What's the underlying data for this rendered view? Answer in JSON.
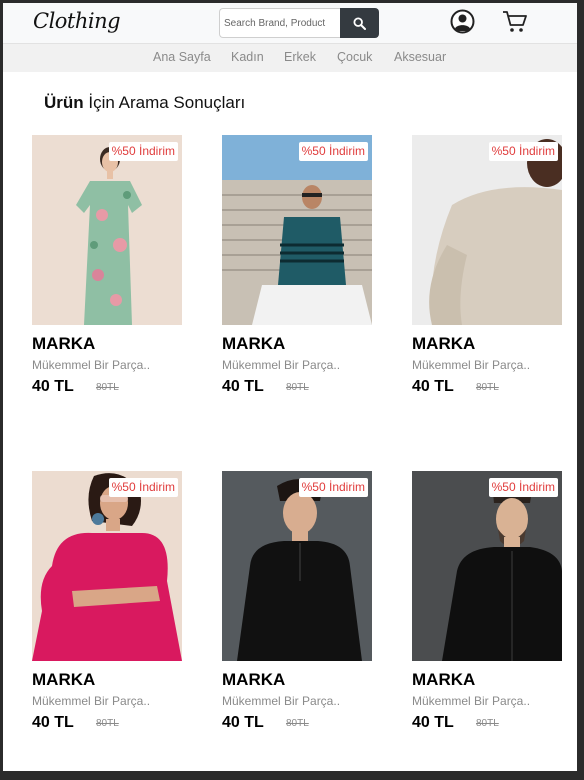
{
  "header": {
    "logo": "Clothing",
    "search": {
      "placeholder": "Search Brand, Product",
      "value": ""
    },
    "icons": {
      "search": "search-icon",
      "user": "user-account-icon",
      "cart": "shopping-cart-icon"
    }
  },
  "nav": {
    "items": [
      {
        "label": "Ana Sayfa"
      },
      {
        "label": "Kadın"
      },
      {
        "label": "Erkek"
      },
      {
        "label": "Çocuk"
      },
      {
        "label": "Aksesuar"
      }
    ]
  },
  "page": {
    "title_bold": "Ürün",
    "title_rest": " İçin Arama Sonuçları"
  },
  "products": [
    {
      "badge": "%50 İndirim",
      "brand": "MARKA",
      "description": "Mükemmel Bir Parça..",
      "price": "40 TL",
      "old_price": "80TL",
      "image": "woman in green floral dress"
    },
    {
      "badge": "%50 İndirim",
      "brand": "MARKA",
      "description": "Mükemmel Bir Parça..",
      "price": "40 TL",
      "old_price": "80TL",
      "image": "man in striped teal t-shirt on stairs"
    },
    {
      "badge": "%50 İndirim",
      "brand": "MARKA",
      "description": "Mükemmel Bir Parça..",
      "price": "40 TL",
      "old_price": "80TL",
      "image": "man in beige sweatshirt"
    },
    {
      "badge": "%50 İndirim",
      "brand": "MARKA",
      "description": "Mükemmel Bir Parça..",
      "price": "40 TL",
      "old_price": "80TL",
      "image": "woman in pink puff-sleeve top"
    },
    {
      "badge": "%50 İndirim",
      "brand": "MARKA",
      "description": "Mükemmel Bir Parça..",
      "price": "40 TL",
      "old_price": "80TL",
      "image": "man in black kurta shirt"
    },
    {
      "badge": "%50 İndirim",
      "brand": "MARKA",
      "description": "Mükemmel Bir Parça..",
      "price": "40 TL",
      "old_price": "80TL",
      "image": "man in black button shirt"
    }
  ],
  "colors": {
    "badge_text": "#e03c3c",
    "search_button": "#343a40",
    "nav_text": "#8a8a8a"
  }
}
